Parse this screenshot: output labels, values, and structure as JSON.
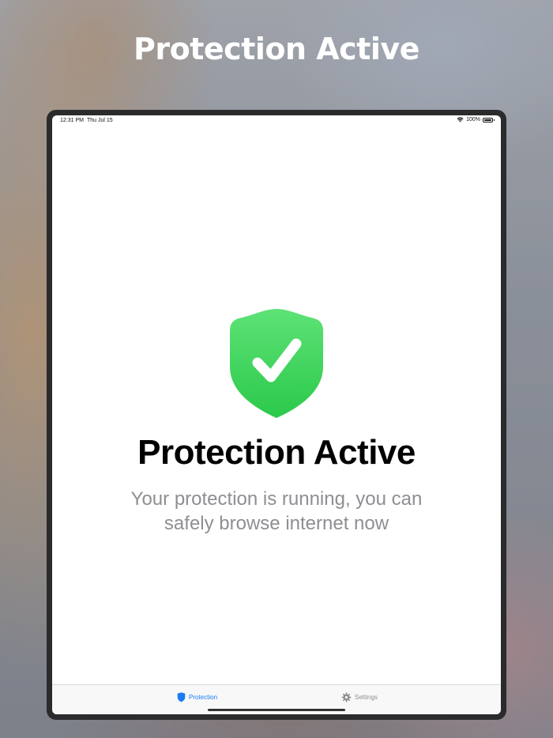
{
  "headline": "Protection Active",
  "status_bar": {
    "time": "12:31 PM",
    "date": "Thu Jul 15",
    "battery": "100%",
    "battery_level": 1.0
  },
  "main": {
    "icon": "shield-checkmark-icon",
    "title": "Protection Active",
    "subtitle": "Your protection is running, you can safely browse internet now"
  },
  "tab_bar": {
    "tabs": [
      {
        "label": "Protection",
        "icon": "shield-icon",
        "selected": true
      },
      {
        "label": "Settings",
        "icon": "gear-icon",
        "selected": false
      }
    ]
  },
  "colors": {
    "accent": "#1a7cf5",
    "shield_green_top": "#5ee276",
    "shield_green_bottom": "#2bc94b",
    "inactive_tab": "#8e8e93",
    "subtitle": "#8e8e93"
  }
}
